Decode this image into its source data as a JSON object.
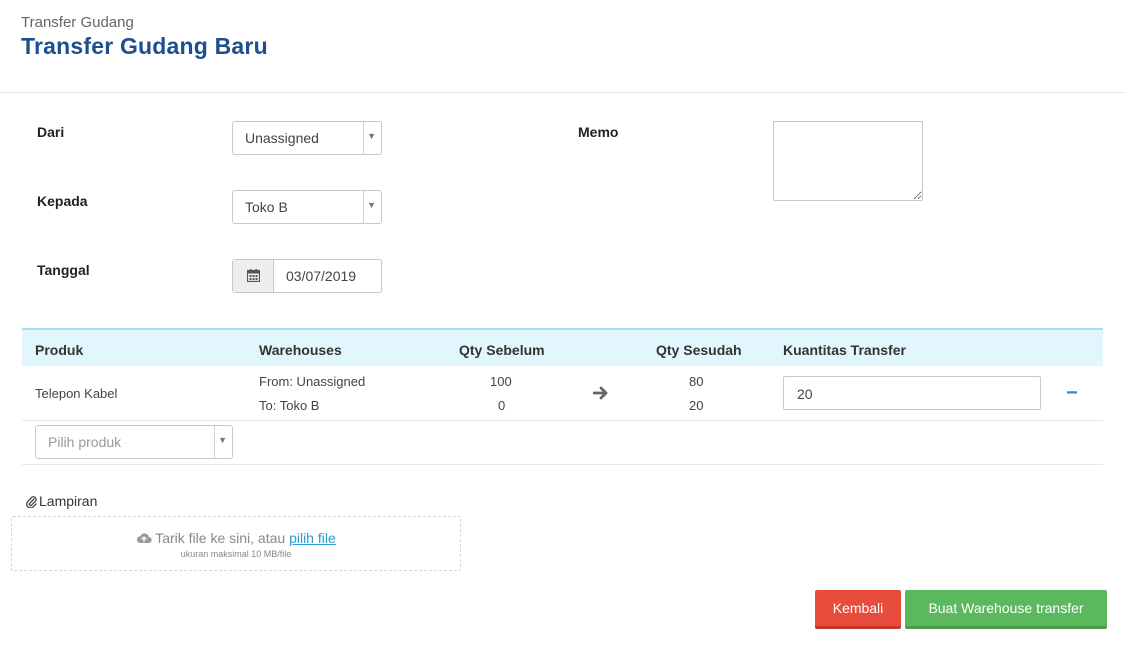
{
  "header": {
    "breadcrumb": "Transfer Gudang",
    "title": "Transfer Gudang Baru"
  },
  "form": {
    "from_label": "Dari",
    "from_value": "Unassigned",
    "to_label": "Kepada",
    "to_value": "Toko B",
    "date_label": "Tanggal",
    "date_value": "03/07/2019",
    "memo_label": "Memo",
    "memo_value": ""
  },
  "table": {
    "headers": {
      "product": "Produk",
      "warehouses": "Warehouses",
      "qty_before": "Qty Sebelum",
      "qty_after": "Qty Sesudah",
      "transfer_qty": "Kuantitas Transfer"
    },
    "rows": [
      {
        "product": "Telepon Kabel",
        "from": "From: Unassigned",
        "to": "To: Toko B",
        "before_from": "100",
        "before_to": "0",
        "after_from": "80",
        "after_to": "20",
        "transfer_qty": "20",
        "remove": "−"
      }
    ],
    "add_product_placeholder": "Pilih produk"
  },
  "attachment": {
    "label": "Lampiran",
    "drop_text": "Tarik file ke sini, atau",
    "pick_link": "pilih file",
    "size_note": "ukuran maksimal 10 MB/file"
  },
  "actions": {
    "back_label": "Kembali",
    "create_label": "Buat Warehouse transfer"
  },
  "colors": {
    "title": "#1b4f8f",
    "table_header_bg": "#e1f6fd",
    "back_button": "#e74c3c",
    "create_button": "#5cb85c",
    "link": "#2a9bd4"
  },
  "icons": {
    "calendar": "calendar-icon",
    "arrow": "arrow-right-icon",
    "paperclip": "paperclip-icon",
    "upload": "cloud-upload-icon",
    "caret": "caret-down-icon"
  }
}
